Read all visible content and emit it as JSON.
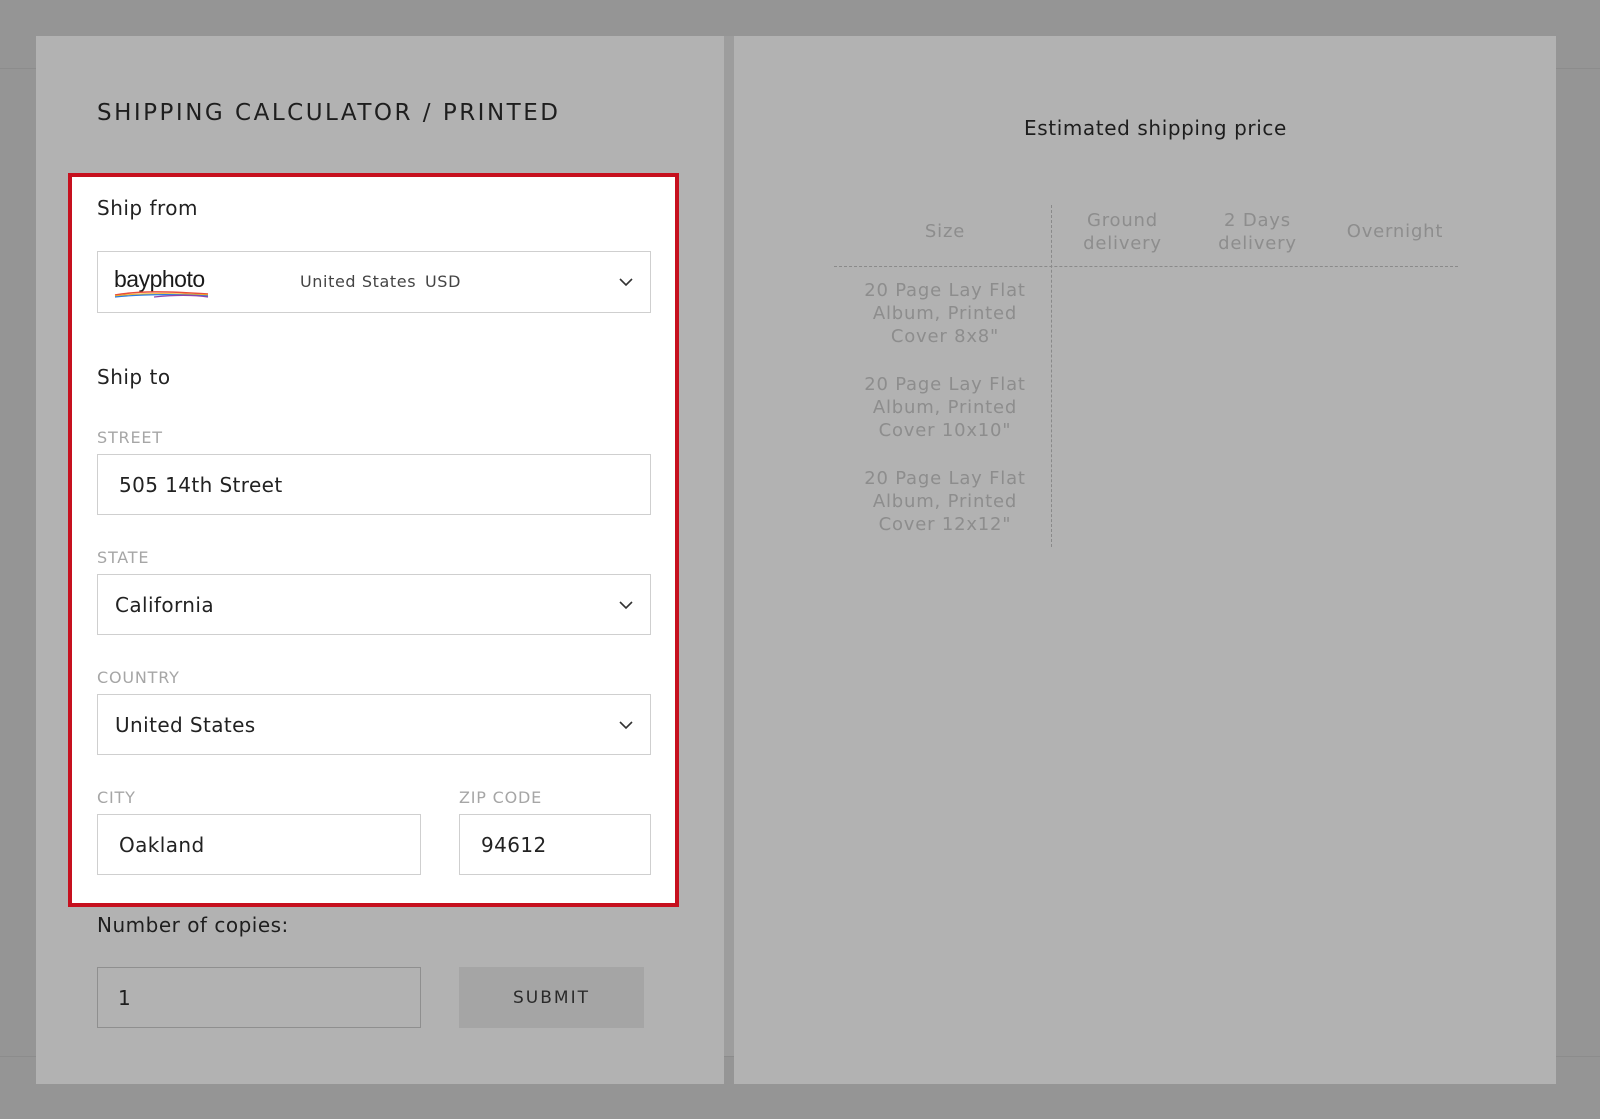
{
  "modal": {
    "title": "SHIPPING CALCULATOR / PRINTED"
  },
  "ship_from": {
    "label": "Ship from",
    "logo_text": "bayphoto",
    "country": "United States",
    "currency": "USD"
  },
  "ship_to": {
    "label": "Ship to",
    "street_label": "STREET",
    "street_value": "505 14th Street",
    "state_label": "STATE",
    "state_value": "California",
    "country_label": "COUNTRY",
    "country_value": "United States",
    "city_label": "CITY",
    "city_value": "Oakland",
    "zip_label": "ZIP CODE",
    "zip_value": "94612"
  },
  "copies": {
    "label": "Number of copies:",
    "value": "1",
    "submit_label": "SUBMIT"
  },
  "estimate": {
    "title": "Estimated shipping price",
    "columns": [
      "Size",
      "Ground\ndelivery",
      "2 Days\ndelivery",
      "Overnight"
    ],
    "rows": [
      "20 Page Lay Flat\nAlbum, Printed\nCover 8x8\"",
      "20 Page Lay Flat\nAlbum, Printed\nCover 10x10\"",
      "20 Page Lay Flat\nAlbum, Printed\nCover 12x12\""
    ]
  },
  "colors": {
    "highlight_border": "#c6101e",
    "overlay_panel": "#b2b2b2",
    "backdrop": "#959595"
  },
  "icons": {
    "select_arrow": "chevron-down-icon"
  }
}
